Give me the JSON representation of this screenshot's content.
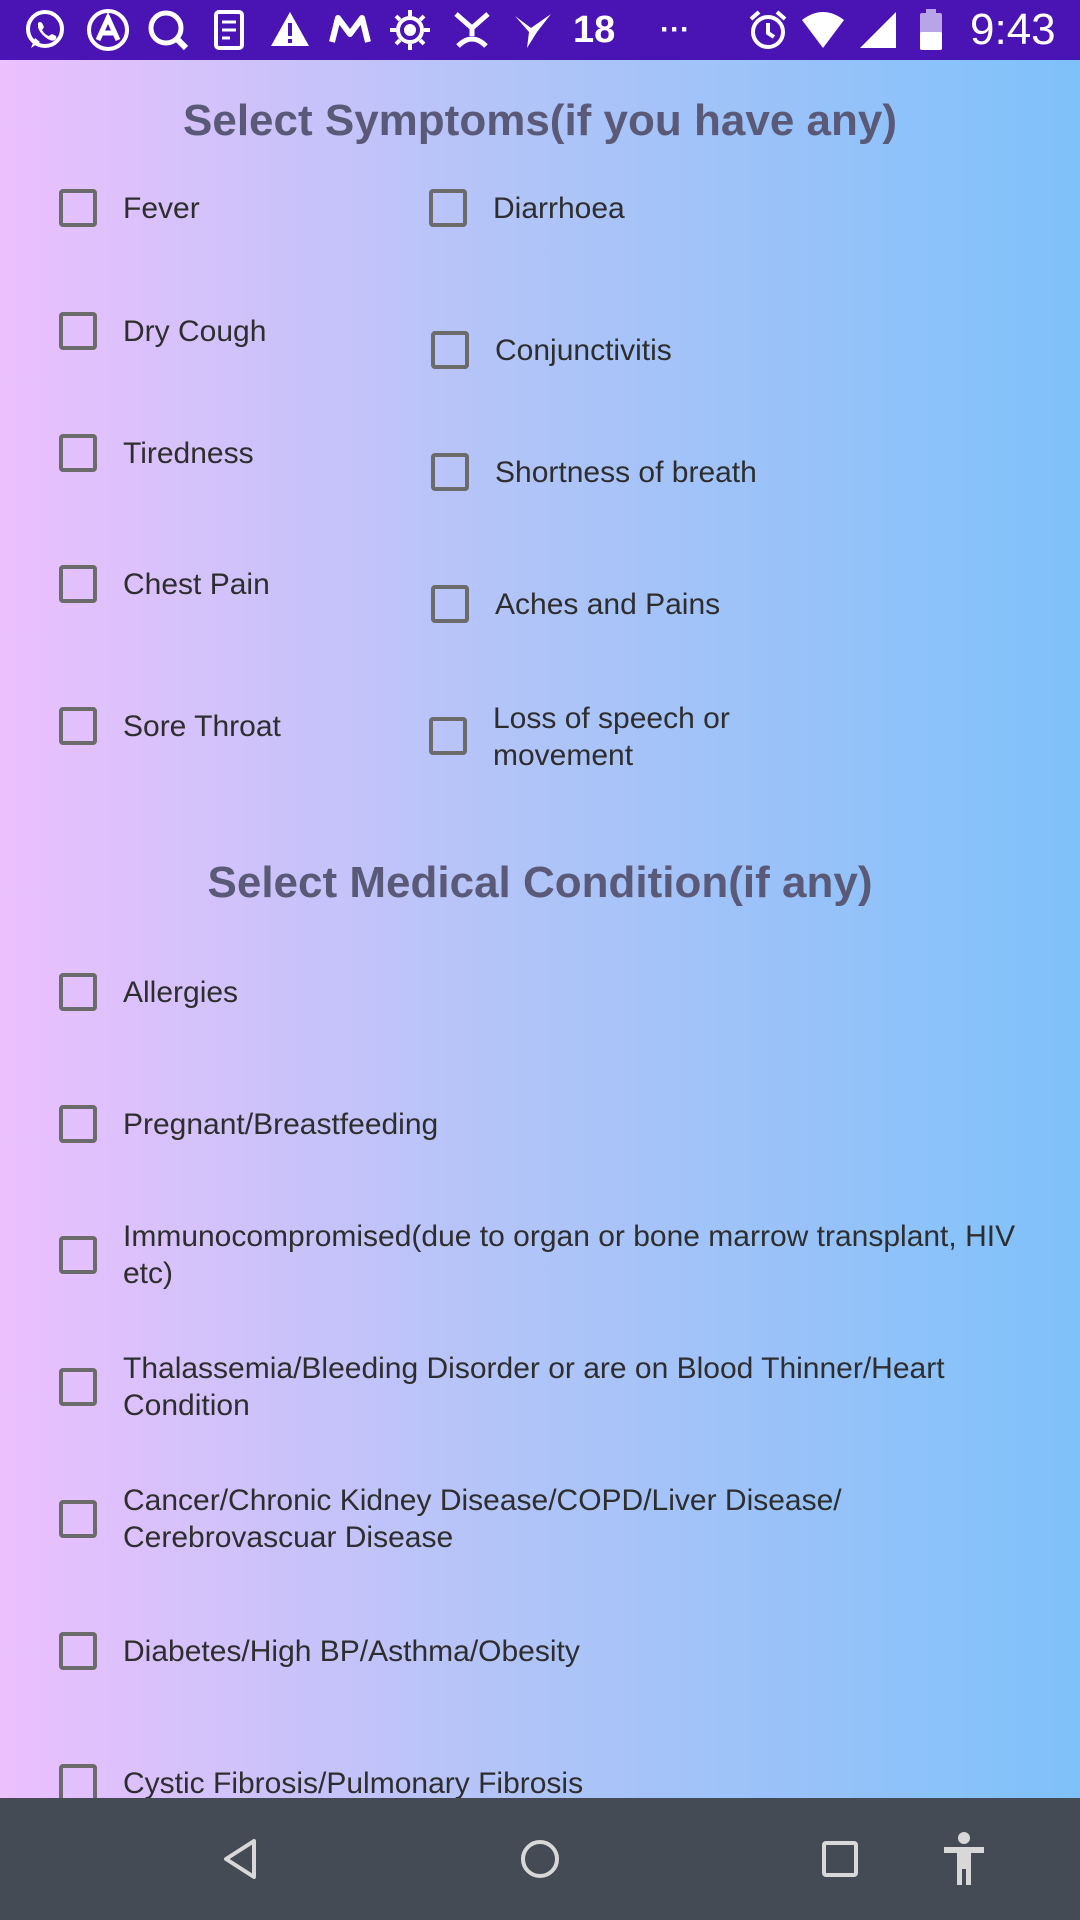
{
  "status_bar": {
    "notification_count": "18",
    "overflow": "···",
    "time": "9:43",
    "background": "#4a14b4",
    "left_icons": [
      "whatsapp-icon",
      "autocad-icon",
      "search-app-icon",
      "document-scanner-icon",
      "warning-icon",
      "gmail-icon",
      "sun-icon",
      "fork-icon",
      "vayu-icon"
    ],
    "right_icons": [
      "alarm-icon",
      "wifi-icon",
      "signal-icon",
      "battery-icon"
    ]
  },
  "symptoms": {
    "title": "Select Symptoms(if you have any)",
    "left_column": [
      "Fever",
      "Dry Cough",
      "Tiredness",
      "Chest Pain",
      "Sore Throat"
    ],
    "right_column": [
      "Diarrhoea",
      "Conjunctivitis",
      "Shortness of breath",
      "Aches and Pains",
      "Loss of speech or movement"
    ]
  },
  "conditions": {
    "title": "Select Medical Condition(if any)",
    "items": [
      "Allergies",
      "Pregnant/Breastfeeding",
      "Immunocompromised(due to organ or bone marrow transplant, HIV etc)",
      "Thalassemia/Bleeding Disorder or are on Blood Thinner/Heart Condition",
      "Cancer/Chronic Kidney Disease/COPD/Liver Disease/ Cerebrovascuar Disease",
      "Diabetes/High BP/Asthma/Obesity",
      "Cystic Fibrosis/Pulmonary Fibrosis"
    ]
  },
  "nav_bar": {
    "buttons": [
      "back-icon",
      "home-icon",
      "recents-icon",
      "accessibility-icon"
    ],
    "background": "#444b54"
  }
}
